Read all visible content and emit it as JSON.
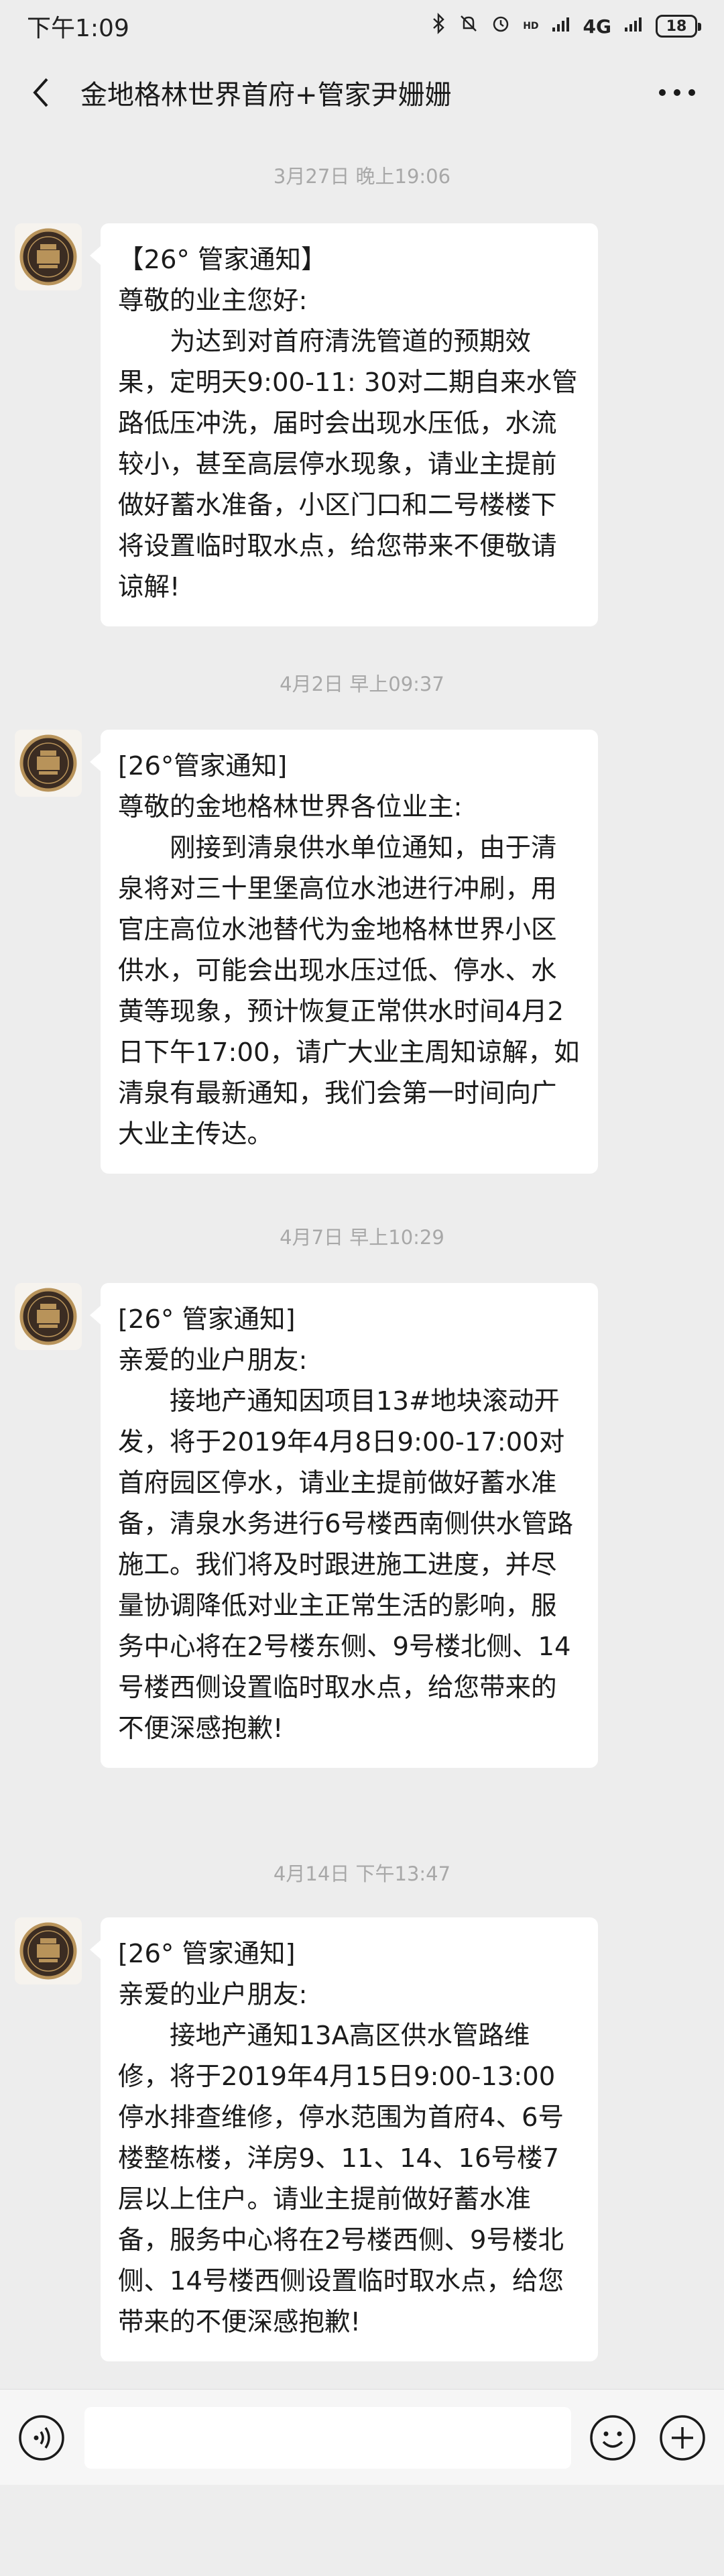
{
  "status_bar": {
    "time": "下午1:09",
    "network": "4G",
    "battery": "18"
  },
  "nav": {
    "title": "金地格林世界首府+管家尹姗姗"
  },
  "messages": [
    {
      "timestamp": "3月27日 晚上19:06",
      "lines": [
        "【26° 管家通知】",
        "尊敬的业主您好:"
      ],
      "body": "为达到对首府清洗管道的预期效果，定明天9:00-11: 30对二期自来水管路低压冲洗，届时会出现水压低，水流较小，甚至高层停水现象，请业主提前做好蓄水准备，小区门口和二号楼楼下将设置临时取水点，给您带来不便敬请谅解!"
    },
    {
      "timestamp": "4月2日 早上09:37",
      "lines": [
        "[26°管家通知]",
        "尊敬的金地格林世界各位业主:"
      ],
      "body": "刚接到清泉供水单位通知，由于清泉将对三十里堡高位水池进行冲刷，用官庄高位水池替代为金地格林世界小区供水，可能会出现水压过低、停水、水黄等现象，预计恢复正常供水时间4月2日下午17:00，请广大业主周知谅解，如清泉有最新通知，我们会第一时间向广大业主传达。"
    },
    {
      "timestamp": "4月7日 早上10:29",
      "lines": [
        "[26° 管家通知]",
        "亲爱的业户朋友:"
      ],
      "body": "接地产通知因项目13#地块滚动开发，将于2019年4月8日9:00-17:00对首府园区停水，请业主提前做好蓄水准备，清泉水务进行6号楼西南侧供水管路施工。我们将及时跟进施工进度，并尽量协调降低对业主正常生活的影响，服务中心将在2号楼东侧、9号楼北侧、14号楼西侧设置临时取水点，给您带来的不便深感抱歉!"
    },
    {
      "timestamp": "4月14日 下午13:47",
      "lines": [
        "[26° 管家通知]",
        "亲爱的业户朋友:"
      ],
      "body": "接地产通知13A高区供水管路维修，将于2019年4月15日9:00-13:00停水排查维修，停水范围为首府4、6号楼整栋楼，洋房9、11、14、16号楼7层以上住户。请业主提前做好蓄水准备，服务中心将在2号楼西侧、9号楼北侧、14号楼西侧设置临时取水点，给您带来的不便深感抱歉!"
    }
  ],
  "input_bar": {
    "placeholder": ""
  },
  "colors": {
    "background": "#ededed",
    "bubble": "#ffffff",
    "timestamp": "#a8a8a8",
    "avatar_gold": "#b8935a",
    "avatar_dark": "#3b2c22"
  }
}
